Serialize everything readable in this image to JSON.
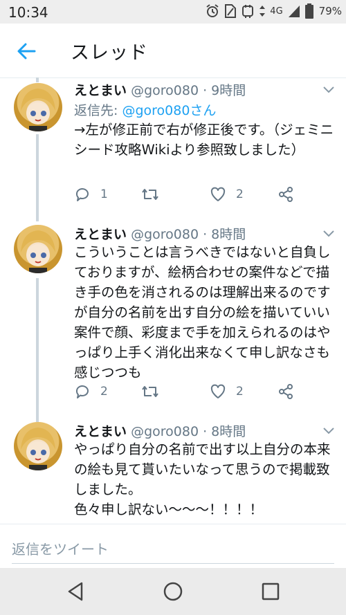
{
  "status_bar": {
    "time": "10:34",
    "network": "4G",
    "battery": "79%"
  },
  "header": {
    "title": "スレッド",
    "back_icon": "back-arrow-icon"
  },
  "colors": {
    "accent": "#1da1f2",
    "muted": "#657786",
    "thread_line": "#ccd6dd"
  },
  "tweets": [
    {
      "name": "えとまい",
      "handle": "@goro080",
      "time": "9時間",
      "reply_label": "返信先:",
      "reply_mention": "@goro080さん",
      "text": "→左が修正前で右が修正後です。（ジェミニシード攻略Wikiより参照致しました）",
      "reply_count": "1",
      "retweet_count": "",
      "like_count": "2"
    },
    {
      "name": "えとまい",
      "handle": "@goro080",
      "time": "8時間",
      "text": "こういうことは言うべきではないと自負しておりますが、絵柄合わせの案件などで描き手の色を消されるのは理解出来るのですが自分の名前を出す自分の絵を描いていい案件で顔、彩度まで手を加えられるのはやっぱり上手く消化出来なくて申し訳なさも感じつつも",
      "reply_count": "2",
      "retweet_count": "",
      "like_count": "2"
    },
    {
      "name": "えとまい",
      "handle": "@goro080",
      "time": "8時間",
      "text": "やっぱり自分の名前で出す以上自分の本来の絵も見て貰いたいなって思うので掲載致しました。\n色々申し訳ない〜〜〜！！！！"
    }
  ],
  "separator": "·",
  "reply_bar": {
    "placeholder": "返信をツイート"
  },
  "nav_bar": {
    "back_icon": "nav-back-icon",
    "home_icon": "nav-home-icon",
    "recents_icon": "nav-recents-icon"
  }
}
